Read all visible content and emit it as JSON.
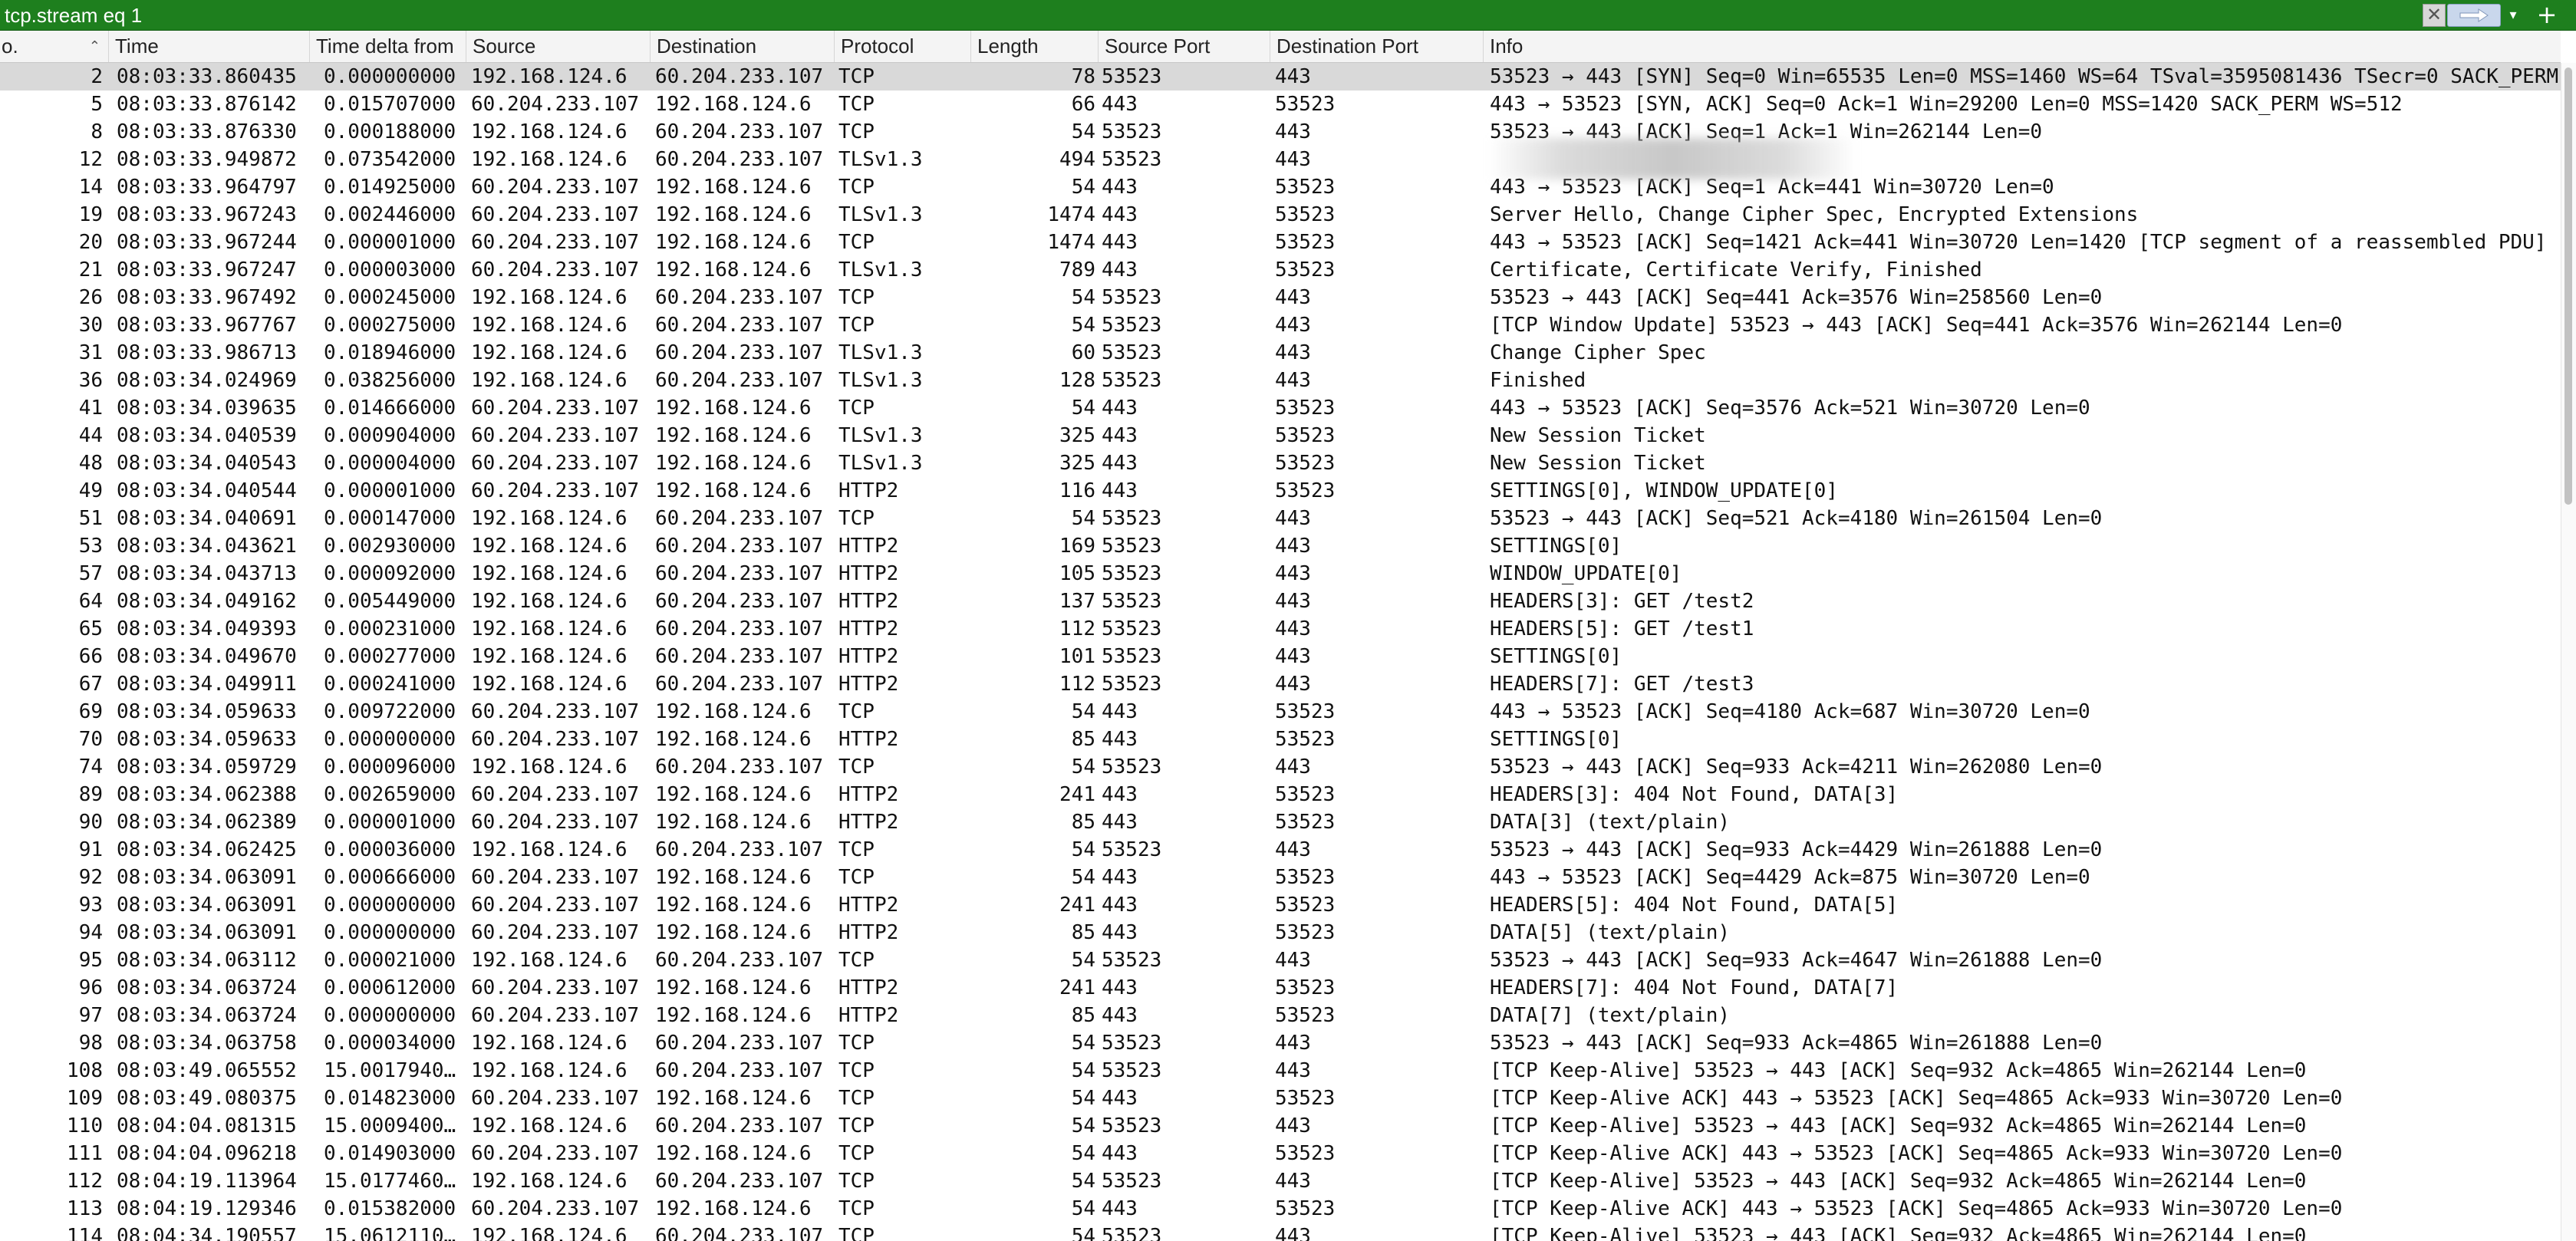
{
  "filter": {
    "value": "tcp.stream eq 1",
    "clear_icon": "clear-icon",
    "apply_icon": "apply-arrow-icon",
    "dropdown_icon": "chevron-down-icon",
    "add_icon": "plus-icon",
    "bar_color": "#1e7f1e"
  },
  "columns": [
    {
      "key": "no",
      "label": "o."
    },
    {
      "key": "time",
      "label": "Time"
    },
    {
      "key": "delta",
      "label": "Time delta from"
    },
    {
      "key": "src",
      "label": "Source"
    },
    {
      "key": "dst",
      "label": "Destination"
    },
    {
      "key": "proto",
      "label": "Protocol"
    },
    {
      "key": "len",
      "label": "Length"
    },
    {
      "key": "sport",
      "label": "Source Port"
    },
    {
      "key": "dport",
      "label": "Destination Port"
    },
    {
      "key": "info",
      "label": "Info"
    }
  ],
  "sort_icon": "sort-ascending-icon",
  "selected_row_color": "#d9d9d9",
  "packets": [
    {
      "no": "2",
      "time": "08:03:33.860435",
      "delta": "0.000000000",
      "src": "192.168.124.6",
      "dst": "60.204.233.107",
      "proto": "TCP",
      "len": "78",
      "sport": "53523",
      "dport": "443",
      "info": "53523 → 443 [SYN] Seq=0 Win=65535 Len=0 MSS=1460 WS=64 TSval=3595081436 TSecr=0 SACK_PERM",
      "selected": true
    },
    {
      "no": "5",
      "time": "08:03:33.876142",
      "delta": "0.015707000",
      "src": "60.204.233.107",
      "dst": "192.168.124.6",
      "proto": "TCP",
      "len": "66",
      "sport": "443",
      "dport": "53523",
      "info": "443 → 53523 [SYN, ACK] Seq=0 Ack=1 Win=29200 Len=0 MSS=1420 SACK_PERM WS=512"
    },
    {
      "no": "8",
      "time": "08:03:33.876330",
      "delta": "0.000188000",
      "src": "192.168.124.6",
      "dst": "60.204.233.107",
      "proto": "TCP",
      "len": "54",
      "sport": "53523",
      "dport": "443",
      "info": "53523 → 443 [ACK] Seq=1 Ack=1 Win=262144 Len=0"
    },
    {
      "no": "12",
      "time": "08:03:33.949872",
      "delta": "0.073542000",
      "src": "192.168.124.6",
      "dst": "60.204.233.107",
      "proto": "TLSv1.3",
      "len": "494",
      "sport": "53523",
      "dport": "443",
      "info": ""
    },
    {
      "no": "14",
      "time": "08:03:33.964797",
      "delta": "0.014925000",
      "src": "60.204.233.107",
      "dst": "192.168.124.6",
      "proto": "TCP",
      "len": "54",
      "sport": "443",
      "dport": "53523",
      "info": "443 → 53523 [ACK] Seq=1 Ack=441 Win=30720 Len=0"
    },
    {
      "no": "19",
      "time": "08:03:33.967243",
      "delta": "0.002446000",
      "src": "60.204.233.107",
      "dst": "192.168.124.6",
      "proto": "TLSv1.3",
      "len": "1474",
      "sport": "443",
      "dport": "53523",
      "info": "Server Hello, Change Cipher Spec, Encrypted Extensions"
    },
    {
      "no": "20",
      "time": "08:03:33.967244",
      "delta": "0.000001000",
      "src": "60.204.233.107",
      "dst": "192.168.124.6",
      "proto": "TCP",
      "len": "1474",
      "sport": "443",
      "dport": "53523",
      "info": "443 → 53523 [ACK] Seq=1421 Ack=441 Win=30720 Len=1420 [TCP segment of a reassembled PDU]"
    },
    {
      "no": "21",
      "time": "08:03:33.967247",
      "delta": "0.000003000",
      "src": "60.204.233.107",
      "dst": "192.168.124.6",
      "proto": "TLSv1.3",
      "len": "789",
      "sport": "443",
      "dport": "53523",
      "info": "Certificate, Certificate Verify, Finished"
    },
    {
      "no": "26",
      "time": "08:03:33.967492",
      "delta": "0.000245000",
      "src": "192.168.124.6",
      "dst": "60.204.233.107",
      "proto": "TCP",
      "len": "54",
      "sport": "53523",
      "dport": "443",
      "info": "53523 → 443 [ACK] Seq=441 Ack=3576 Win=258560 Len=0"
    },
    {
      "no": "30",
      "time": "08:03:33.967767",
      "delta": "0.000275000",
      "src": "192.168.124.6",
      "dst": "60.204.233.107",
      "proto": "TCP",
      "len": "54",
      "sport": "53523",
      "dport": "443",
      "info": "[TCP Window Update] 53523 → 443 [ACK] Seq=441 Ack=3576 Win=262144 Len=0"
    },
    {
      "no": "31",
      "time": "08:03:33.986713",
      "delta": "0.018946000",
      "src": "192.168.124.6",
      "dst": "60.204.233.107",
      "proto": "TLSv1.3",
      "len": "60",
      "sport": "53523",
      "dport": "443",
      "info": "Change Cipher Spec"
    },
    {
      "no": "36",
      "time": "08:03:34.024969",
      "delta": "0.038256000",
      "src": "192.168.124.6",
      "dst": "60.204.233.107",
      "proto": "TLSv1.3",
      "len": "128",
      "sport": "53523",
      "dport": "443",
      "info": "Finished"
    },
    {
      "no": "41",
      "time": "08:03:34.039635",
      "delta": "0.014666000",
      "src": "60.204.233.107",
      "dst": "192.168.124.6",
      "proto": "TCP",
      "len": "54",
      "sport": "443",
      "dport": "53523",
      "info": "443 → 53523 [ACK] Seq=3576 Ack=521 Win=30720 Len=0"
    },
    {
      "no": "44",
      "time": "08:03:34.040539",
      "delta": "0.000904000",
      "src": "60.204.233.107",
      "dst": "192.168.124.6",
      "proto": "TLSv1.3",
      "len": "325",
      "sport": "443",
      "dport": "53523",
      "info": "New Session Ticket"
    },
    {
      "no": "48",
      "time": "08:03:34.040543",
      "delta": "0.000004000",
      "src": "60.204.233.107",
      "dst": "192.168.124.6",
      "proto": "TLSv1.3",
      "len": "325",
      "sport": "443",
      "dport": "53523",
      "info": "New Session Ticket"
    },
    {
      "no": "49",
      "time": "08:03:34.040544",
      "delta": "0.000001000",
      "src": "60.204.233.107",
      "dst": "192.168.124.6",
      "proto": "HTTP2",
      "len": "116",
      "sport": "443",
      "dport": "53523",
      "info": "SETTINGS[0], WINDOW_UPDATE[0]"
    },
    {
      "no": "51",
      "time": "08:03:34.040691",
      "delta": "0.000147000",
      "src": "192.168.124.6",
      "dst": "60.204.233.107",
      "proto": "TCP",
      "len": "54",
      "sport": "53523",
      "dport": "443",
      "info": "53523 → 443 [ACK] Seq=521 Ack=4180 Win=261504 Len=0"
    },
    {
      "no": "53",
      "time": "08:03:34.043621",
      "delta": "0.002930000",
      "src": "192.168.124.6",
      "dst": "60.204.233.107",
      "proto": "HTTP2",
      "len": "169",
      "sport": "53523",
      "dport": "443",
      "info": "SETTINGS[0]"
    },
    {
      "no": "57",
      "time": "08:03:34.043713",
      "delta": "0.000092000",
      "src": "192.168.124.6",
      "dst": "60.204.233.107",
      "proto": "HTTP2",
      "len": "105",
      "sport": "53523",
      "dport": "443",
      "info": "WINDOW_UPDATE[0]"
    },
    {
      "no": "64",
      "time": "08:03:34.049162",
      "delta": "0.005449000",
      "src": "192.168.124.6",
      "dst": "60.204.233.107",
      "proto": "HTTP2",
      "len": "137",
      "sport": "53523",
      "dport": "443",
      "info": "HEADERS[3]: GET /test2"
    },
    {
      "no": "65",
      "time": "08:03:34.049393",
      "delta": "0.000231000",
      "src": "192.168.124.6",
      "dst": "60.204.233.107",
      "proto": "HTTP2",
      "len": "112",
      "sport": "53523",
      "dport": "443",
      "info": "HEADERS[5]: GET /test1"
    },
    {
      "no": "66",
      "time": "08:03:34.049670",
      "delta": "0.000277000",
      "src": "192.168.124.6",
      "dst": "60.204.233.107",
      "proto": "HTTP2",
      "len": "101",
      "sport": "53523",
      "dport": "443",
      "info": "SETTINGS[0]"
    },
    {
      "no": "67",
      "time": "08:03:34.049911",
      "delta": "0.000241000",
      "src": "192.168.124.6",
      "dst": "60.204.233.107",
      "proto": "HTTP2",
      "len": "112",
      "sport": "53523",
      "dport": "443",
      "info": "HEADERS[7]: GET /test3"
    },
    {
      "no": "69",
      "time": "08:03:34.059633",
      "delta": "0.009722000",
      "src": "60.204.233.107",
      "dst": "192.168.124.6",
      "proto": "TCP",
      "len": "54",
      "sport": "443",
      "dport": "53523",
      "info": "443 → 53523 [ACK] Seq=4180 Ack=687 Win=30720 Len=0"
    },
    {
      "no": "70",
      "time": "08:03:34.059633",
      "delta": "0.000000000",
      "src": "60.204.233.107",
      "dst": "192.168.124.6",
      "proto": "HTTP2",
      "len": "85",
      "sport": "443",
      "dport": "53523",
      "info": "SETTINGS[0]"
    },
    {
      "no": "74",
      "time": "08:03:34.059729",
      "delta": "0.000096000",
      "src": "192.168.124.6",
      "dst": "60.204.233.107",
      "proto": "TCP",
      "len": "54",
      "sport": "53523",
      "dport": "443",
      "info": "53523 → 443 [ACK] Seq=933 Ack=4211 Win=262080 Len=0"
    },
    {
      "no": "89",
      "time": "08:03:34.062388",
      "delta": "0.002659000",
      "src": "60.204.233.107",
      "dst": "192.168.124.6",
      "proto": "HTTP2",
      "len": "241",
      "sport": "443",
      "dport": "53523",
      "info": "HEADERS[3]: 404 Not Found, DATA[3]"
    },
    {
      "no": "90",
      "time": "08:03:34.062389",
      "delta": "0.000001000",
      "src": "60.204.233.107",
      "dst": "192.168.124.6",
      "proto": "HTTP2",
      "len": "85",
      "sport": "443",
      "dport": "53523",
      "info": "DATA[3] (text/plain)"
    },
    {
      "no": "91",
      "time": "08:03:34.062425",
      "delta": "0.000036000",
      "src": "192.168.124.6",
      "dst": "60.204.233.107",
      "proto": "TCP",
      "len": "54",
      "sport": "53523",
      "dport": "443",
      "info": "53523 → 443 [ACK] Seq=933 Ack=4429 Win=261888 Len=0"
    },
    {
      "no": "92",
      "time": "08:03:34.063091",
      "delta": "0.000666000",
      "src": "60.204.233.107",
      "dst": "192.168.124.6",
      "proto": "TCP",
      "len": "54",
      "sport": "443",
      "dport": "53523",
      "info": "443 → 53523 [ACK] Seq=4429 Ack=875 Win=30720 Len=0"
    },
    {
      "no": "93",
      "time": "08:03:34.063091",
      "delta": "0.000000000",
      "src": "60.204.233.107",
      "dst": "192.168.124.6",
      "proto": "HTTP2",
      "len": "241",
      "sport": "443",
      "dport": "53523",
      "info": "HEADERS[5]: 404 Not Found, DATA[5]"
    },
    {
      "no": "94",
      "time": "08:03:34.063091",
      "delta": "0.000000000",
      "src": "60.204.233.107",
      "dst": "192.168.124.6",
      "proto": "HTTP2",
      "len": "85",
      "sport": "443",
      "dport": "53523",
      "info": "DATA[5] (text/plain)"
    },
    {
      "no": "95",
      "time": "08:03:34.063112",
      "delta": "0.000021000",
      "src": "192.168.124.6",
      "dst": "60.204.233.107",
      "proto": "TCP",
      "len": "54",
      "sport": "53523",
      "dport": "443",
      "info": "53523 → 443 [ACK] Seq=933 Ack=4647 Win=261888 Len=0"
    },
    {
      "no": "96",
      "time": "08:03:34.063724",
      "delta": "0.000612000",
      "src": "60.204.233.107",
      "dst": "192.168.124.6",
      "proto": "HTTP2",
      "len": "241",
      "sport": "443",
      "dport": "53523",
      "info": "HEADERS[7]: 404 Not Found, DATA[7]"
    },
    {
      "no": "97",
      "time": "08:03:34.063724",
      "delta": "0.000000000",
      "src": "60.204.233.107",
      "dst": "192.168.124.6",
      "proto": "HTTP2",
      "len": "85",
      "sport": "443",
      "dport": "53523",
      "info": "DATA[7] (text/plain)"
    },
    {
      "no": "98",
      "time": "08:03:34.063758",
      "delta": "0.000034000",
      "src": "192.168.124.6",
      "dst": "60.204.233.107",
      "proto": "TCP",
      "len": "54",
      "sport": "53523",
      "dport": "443",
      "info": "53523 → 443 [ACK] Seq=933 Ack=4865 Win=261888 Len=0"
    },
    {
      "no": "108",
      "time": "08:03:49.065552",
      "delta": "15.0017940…",
      "src": "192.168.124.6",
      "dst": "60.204.233.107",
      "proto": "TCP",
      "len": "54",
      "sport": "53523",
      "dport": "443",
      "info": "[TCP Keep-Alive] 53523 → 443 [ACK] Seq=932 Ack=4865 Win=262144 Len=0"
    },
    {
      "no": "109",
      "time": "08:03:49.080375",
      "delta": "0.014823000",
      "src": "60.204.233.107",
      "dst": "192.168.124.6",
      "proto": "TCP",
      "len": "54",
      "sport": "443",
      "dport": "53523",
      "info": "[TCP Keep-Alive ACK] 443 → 53523 [ACK] Seq=4865 Ack=933 Win=30720 Len=0"
    },
    {
      "no": "110",
      "time": "08:04:04.081315",
      "delta": "15.0009400…",
      "src": "192.168.124.6",
      "dst": "60.204.233.107",
      "proto": "TCP",
      "len": "54",
      "sport": "53523",
      "dport": "443",
      "info": "[TCP Keep-Alive] 53523 → 443 [ACK] Seq=932 Ack=4865 Win=262144 Len=0"
    },
    {
      "no": "111",
      "time": "08:04:04.096218",
      "delta": "0.014903000",
      "src": "60.204.233.107",
      "dst": "192.168.124.6",
      "proto": "TCP",
      "len": "54",
      "sport": "443",
      "dport": "53523",
      "info": "[TCP Keep-Alive ACK] 443 → 53523 [ACK] Seq=4865 Ack=933 Win=30720 Len=0"
    },
    {
      "no": "112",
      "time": "08:04:19.113964",
      "delta": "15.0177460…",
      "src": "192.168.124.6",
      "dst": "60.204.233.107",
      "proto": "TCP",
      "len": "54",
      "sport": "53523",
      "dport": "443",
      "info": "[TCP Keep-Alive] 53523 → 443 [ACK] Seq=932 Ack=4865 Win=262144 Len=0"
    },
    {
      "no": "113",
      "time": "08:04:19.129346",
      "delta": "0.015382000",
      "src": "60.204.233.107",
      "dst": "192.168.124.6",
      "proto": "TCP",
      "len": "54",
      "sport": "443",
      "dport": "53523",
      "info": "[TCP Keep-Alive ACK] 443 → 53523 [ACK] Seq=4865 Ack=933 Win=30720 Len=0"
    },
    {
      "no": "114",
      "time": "08:04:34.190557",
      "delta": "15.0612110…",
      "src": "192.168.124.6",
      "dst": "60.204.233.107",
      "proto": "TCP",
      "len": "54",
      "sport": "53523",
      "dport": "443",
      "info": "[TCP Keep-Alive] 53523 → 443 [ACK] Seq=932 Ack=4865 Win=262144 Len=0"
    }
  ]
}
